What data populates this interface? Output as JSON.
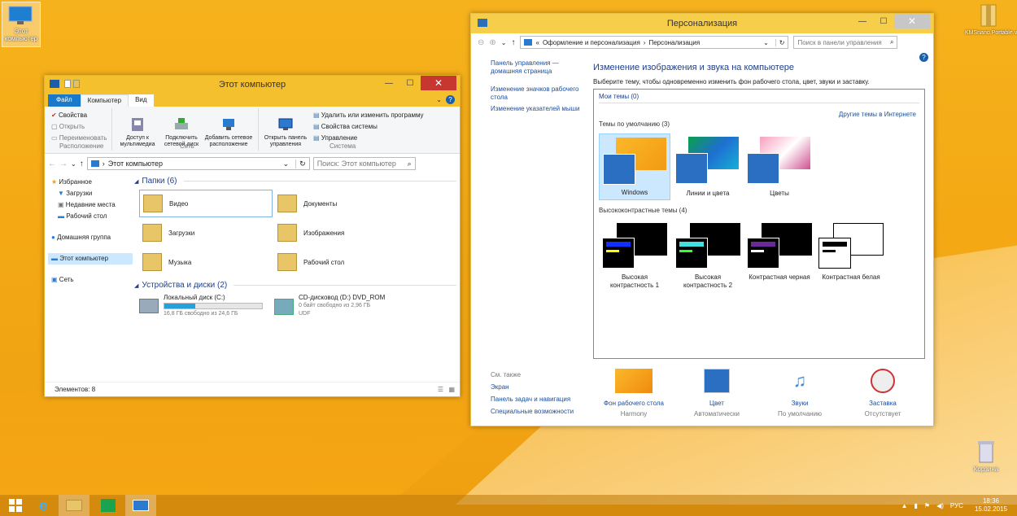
{
  "desktop": {
    "icon_computer": "Этот компьютер",
    "icon_top_right": "KMSnano.Portable.v1...",
    "icon_trash": "Корзина"
  },
  "explorer": {
    "title": "Этот компьютер",
    "tabs": [
      "Файл",
      "Компьютер",
      "Вид"
    ],
    "ribbon": {
      "group1_items": [
        "Свойства",
        "Открыть",
        "Переименовать"
      ],
      "group1_label": "Расположение",
      "media_btn": "Доступ к\nмультимедиа",
      "map_drive_btn": "Подключить\nсетевой диск",
      "add_loc_btn": "Добавить сетевое\nрасположение",
      "group2_label": "Сеть",
      "control_panel_btn": "Открыть панель\nуправления",
      "group3_items": [
        "Удалить или изменить программу",
        "Свойства системы",
        "Управление"
      ],
      "group3_label": "Система"
    },
    "address": "Этот компьютер",
    "search_placeholder": "Поиск: Этот компьютер",
    "nav": {
      "favorites": "Избранное",
      "fav_items": [
        "Загрузки",
        "Недавние места",
        "Рабочий стол"
      ],
      "homegroup": "Домашняя группа",
      "this_pc": "Этот компьютер",
      "network": "Сеть"
    },
    "folders_header": "Папки (6)",
    "folders": [
      "Видео",
      "Документы",
      "Загрузки",
      "Изображения",
      "Музыка",
      "Рабочий стол"
    ],
    "devices_header": "Устройства и диски (2)",
    "drive_c": {
      "name": "Локальный диск (C:)",
      "free": "16,8 ГБ свободно из 24,6 ГБ",
      "used_fraction": 0.32
    },
    "drive_d": {
      "name": "CD-дисковод (D:) DVD_ROM",
      "free": "0 байт свободно из 2,96 ГБ",
      "fs": "UDF"
    },
    "status": "Элементов: 8"
  },
  "personalization": {
    "title": "Персонализация",
    "breadcrumb": [
      "Оформление и персонализация",
      "Персонализация"
    ],
    "breadcrumb_prefix": "«",
    "search_placeholder": "Поиск в панели управления",
    "side": {
      "home": "Панель управления — домашняя страница",
      "links": [
        "Изменение значков рабочего стола",
        "Изменение указателей мыши"
      ],
      "see_also": "См. также",
      "also_links": [
        "Экран",
        "Панель задач и навигация",
        "Специальные возможности"
      ]
    },
    "heading": "Изменение изображения и звука на компьютере",
    "subheading": "Выберите тему, чтобы одновременно изменить фон рабочего стола, цвет, звуки и заставку.",
    "my_themes": "Мои темы (0)",
    "more_online": "Другие темы в Интернете",
    "default_themes": "Темы по умолчанию (3)",
    "themes": [
      "Windows",
      "Линии и цвета",
      "Цветы"
    ],
    "hc_header": "Высококонтрастные темы (4)",
    "hc_themes": [
      "Высокая контрастность 1",
      "Высокая контрастность 2",
      "Контрастная черная",
      "Контрастная белая"
    ],
    "bottom": [
      {
        "label": "Фон рабочего стола",
        "value": "Harmony"
      },
      {
        "label": "Цвет",
        "value": "Автоматически"
      },
      {
        "label": "Звуки",
        "value": "По умолчанию"
      },
      {
        "label": "Заставка",
        "value": "Отсутствует"
      }
    ]
  },
  "taskbar": {
    "lang": "РУС",
    "time": "18:36",
    "date": "15.02.2015"
  }
}
